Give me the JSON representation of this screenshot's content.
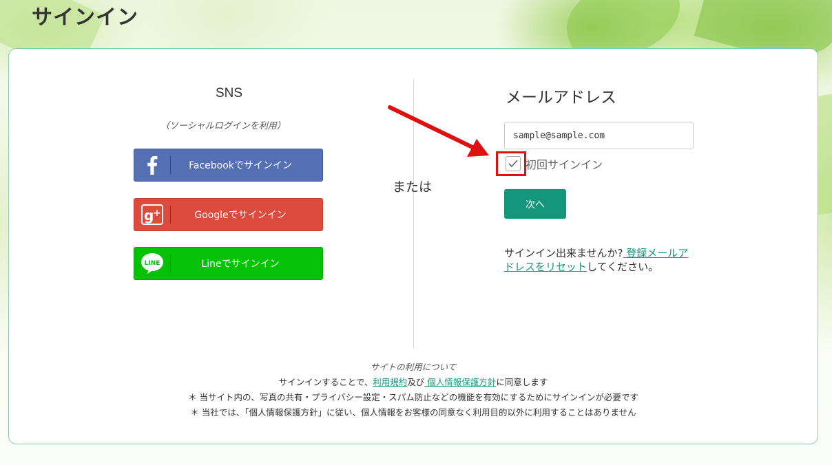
{
  "page": {
    "title": "サインイン"
  },
  "sns": {
    "title": "SNS",
    "subtitle": "（ソーシャルログインを利用）",
    "buttons": [
      {
        "label": "Facebookでサインイン",
        "icon": "facebook-icon",
        "color": "#5470b3"
      },
      {
        "label": "Googleでサインイン",
        "icon": "google-plus-icon",
        "color": "#dc4b3e"
      },
      {
        "label": "Lineでサインイン",
        "icon": "line-icon",
        "color": "#05c206"
      }
    ]
  },
  "or_label": "または",
  "email": {
    "title": "メールアドレス",
    "value": "sample@sample.com",
    "first_signin_label": "初回サインイン",
    "first_signin_checked": true,
    "next_label": "次へ",
    "help_prefix": "サインイン出来ませんか?",
    "help_link": " 登録メールアドレスをリセット",
    "help_suffix": "してください。"
  },
  "terms": {
    "title": "サイトの利用について",
    "line1_prefix": "サインインすることで、",
    "terms_link": "利用規約",
    "line1_mid": "及び",
    "privacy_link": " 個人情報保護方針",
    "line1_suffix": "に同意します",
    "note1": "＊ 当サイト内の、写真の共有・プライバシー設定・スパム防止などの機能を有効にするためにサインインが必要です",
    "note2": "＊ 当社では、「個人情報保護方針」に従い、個人情報をお客様の同意なく利用目的以外に利用することはありません"
  },
  "colors": {
    "accent": "#14967a",
    "annotation": "#e01010"
  }
}
